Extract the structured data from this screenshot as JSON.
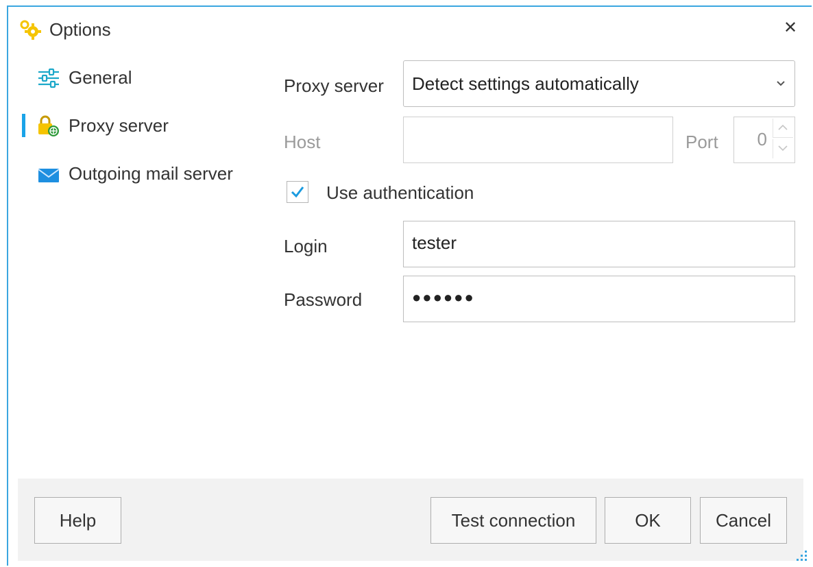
{
  "window": {
    "title": "Options",
    "title_icon": "gears-icon",
    "close_glyph": "✕"
  },
  "sidebar": {
    "items": [
      {
        "label": "General",
        "icon": "sliders-icon",
        "selected": false
      },
      {
        "label": "Proxy server",
        "icon": "lock-globe-icon",
        "selected": true
      },
      {
        "label": "Outgoing mail server",
        "icon": "envelope-icon",
        "selected": false
      }
    ]
  },
  "form": {
    "proxy_server_label": "Proxy server",
    "proxy_server_value": "Detect settings automatically",
    "host_label": "Host",
    "host_value": "",
    "port_label": "Port",
    "port_value": "0",
    "use_auth_label": "Use authentication",
    "use_auth_checked": true,
    "login_label": "Login",
    "login_value": "tester",
    "password_label": "Password",
    "password_mask": "●●●●●●"
  },
  "footer": {
    "help_label": "Help",
    "test_connection_label": "Test connection",
    "ok_label": "OK",
    "cancel_label": "Cancel"
  },
  "colors": {
    "accent": "#1aa3e8",
    "window_border": "#3aa6e0",
    "footer_bg": "#f2f2f2",
    "check": "#1a9be0",
    "gear": "#f5c400"
  }
}
